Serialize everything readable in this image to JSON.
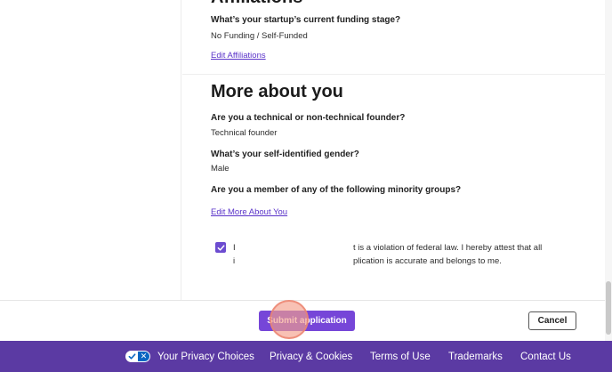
{
  "affiliations": {
    "section_title": "Affiliations",
    "funding_question": "What’s your startup’s current funding stage?",
    "funding_answer": "No Funding / Self-Funded",
    "edit_link": "Edit Affiliations"
  },
  "more_about_you": {
    "title": "More about you",
    "founder_question": "Are you a technical or non-technical founder?",
    "founder_answer": "Technical founder",
    "gender_question": "What’s your self-identified gender?",
    "gender_answer": "Male",
    "minority_question": "Are you a member of any of the following minority groups?",
    "edit_link": "Edit More About You"
  },
  "attestation": {
    "checked": true,
    "line1_start": "I",
    "line1_end": "t is a violation of federal law. I hereby attest that all",
    "line2_start": "i",
    "line2_end": "plication is accurate and belongs to me."
  },
  "actions": {
    "submit_label": "Submit application",
    "cancel_label": "Cancel"
  },
  "footer": {
    "privacy_choices": "Your Privacy Choices",
    "privacy_cookies": "Privacy & Cookies",
    "terms": "Terms of Use",
    "trademarks": "Trademarks",
    "contact": "Contact Us",
    "background_color": "#5b3aa3"
  },
  "colors": {
    "accent": "#7646d8",
    "link": "#5a33c9"
  }
}
